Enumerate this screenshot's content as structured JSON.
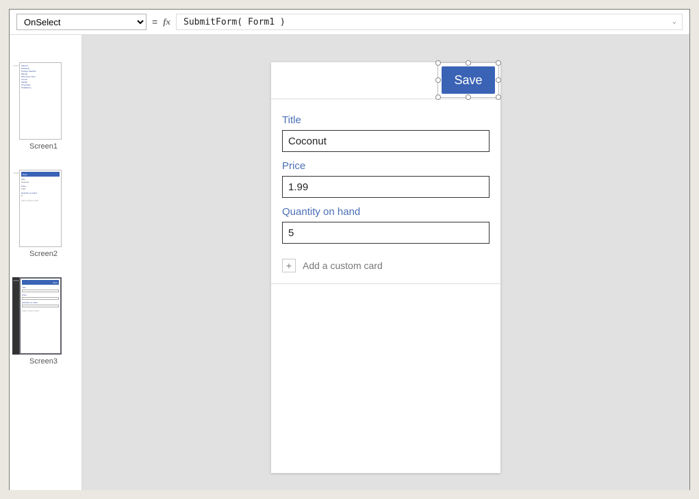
{
  "formula_bar": {
    "selected_property": "OnSelect",
    "equals": "=",
    "fx_label": "fx",
    "formula": "SubmitForm( Form1 )"
  },
  "thumbnails": {
    "dots": "···",
    "screen1": {
      "caption": "Screen1"
    },
    "screen2": {
      "caption": "Screen2",
      "header_text": "Back"
    },
    "screen3": {
      "caption": "Screen3",
      "header_text": "Save"
    }
  },
  "thumb_mini": {
    "title": "Title",
    "price": "Price",
    "qty": "Quantity on hand",
    "add": "Add a custom card",
    "t_val": "Coconut",
    "p_val": "1.99",
    "q_val": "5"
  },
  "form": {
    "save_label": "Save",
    "fields": {
      "title": {
        "label": "Title",
        "value": "Coconut"
      },
      "price": {
        "label": "Price",
        "value": "1.99"
      },
      "qty": {
        "label": "Quantity on hand",
        "value": "5"
      }
    },
    "add_card_label": "Add a custom card",
    "plus": "+"
  }
}
